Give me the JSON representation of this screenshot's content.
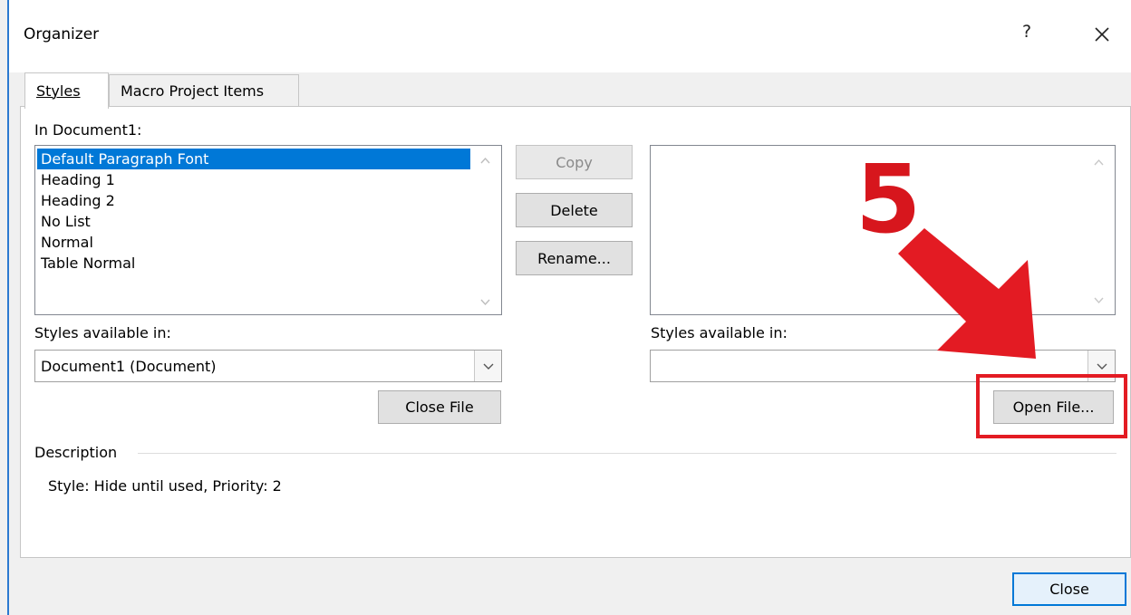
{
  "window": {
    "title": "Organizer",
    "help_glyph": "?",
    "close_glyph": "✕"
  },
  "tabs": [
    {
      "label": "Styles",
      "active": true
    },
    {
      "label": "Macro Project Items",
      "active": false
    }
  ],
  "left": {
    "list_label": "In Document1:",
    "items": [
      "Default Paragraph Font",
      "Heading 1",
      "Heading 2",
      "No List",
      "Normal",
      "Table Normal"
    ],
    "selected_index": 0,
    "available_label": "Styles available in:",
    "available_value": "Document1 (Document)",
    "close_file_label": "Close File"
  },
  "middle": {
    "copy_label": "Copy",
    "delete_label": "Delete",
    "rename_label": "Rename..."
  },
  "right": {
    "items": [],
    "available_label": "Styles available in:",
    "available_value": "",
    "open_file_label": "Open File..."
  },
  "description": {
    "heading": "Description",
    "text": "Style: Hide until used, Priority: 2"
  },
  "footer": {
    "close_label": "Close"
  },
  "annotation": {
    "step_number": "5",
    "color": "#e31b23"
  },
  "icons": {
    "scroll_up": "scroll-up-icon",
    "scroll_down": "scroll-down-icon",
    "dropdown": "chevron-down-icon"
  }
}
